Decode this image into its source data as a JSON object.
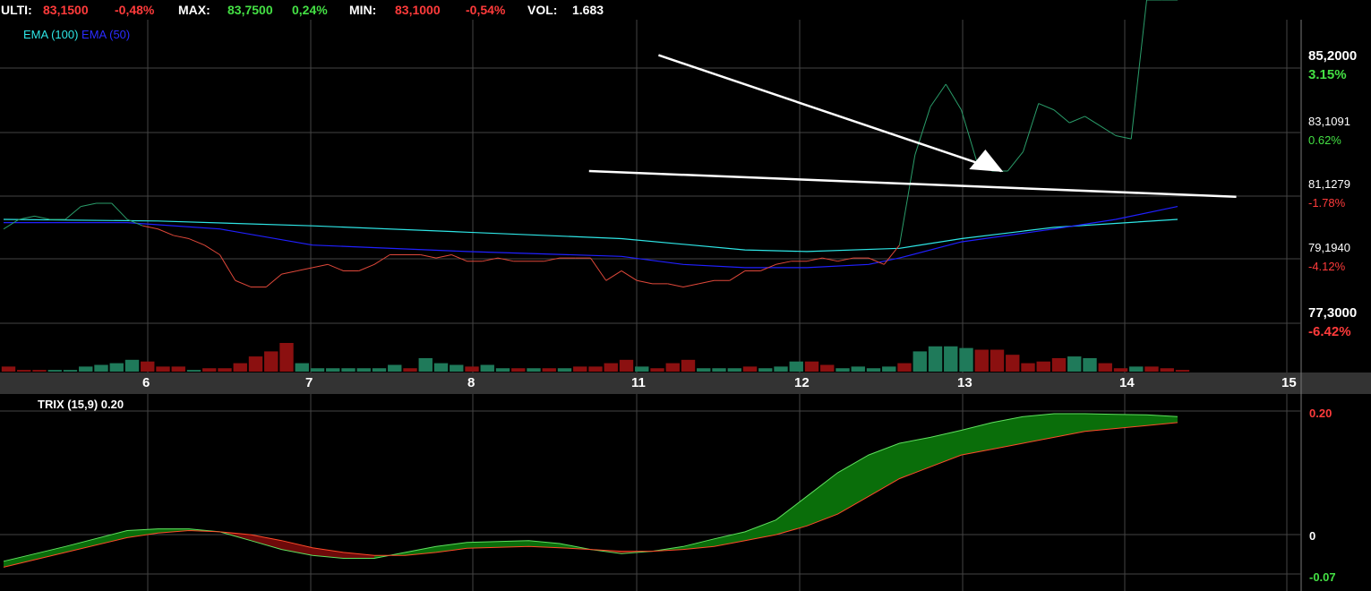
{
  "header": {
    "last_label": "ULTI:",
    "last_value": "83,1500",
    "last_change": "-0,48%",
    "max_label": "MAX:",
    "max_value": "83,7500",
    "max_change": "0,24%",
    "min_label": "MIN:",
    "min_value": "83,1000",
    "min_change": "-0,54%",
    "vol_label": "VOL:",
    "vol_value": "1.683"
  },
  "legend": {
    "ema100": "EMA (100)",
    "ema50": "EMA (50)"
  },
  "trix_title": "TRIX (15,9) 0.20",
  "colors": {
    "ema100": "#2ee6e6",
    "ema50": "#2020ff",
    "price_up": "#2a9d6a",
    "price_down": "#e0483a",
    "vol_up": "#1f7a5a",
    "vol_down": "#8b1010",
    "trix_up": "#0a6e0a",
    "trix_down": "#6e0a0a",
    "pos": "#44e044",
    "neg": "#ff3b3b"
  },
  "chart_data": [
    {
      "type": "line",
      "title": "",
      "x_ticks": [
        "6",
        "7",
        "8",
        "11",
        "12",
        "13",
        "14",
        "15"
      ],
      "y_labels": [
        {
          "value": "85,2000",
          "pct": "3.15%",
          "sign": "pos",
          "big": true
        },
        {
          "value": "83,1091",
          "pct": "0.62%",
          "sign": "pos",
          "big": false
        },
        {
          "value": "81,1279",
          "pct": "-1.78%",
          "sign": "neg",
          "big": false
        },
        {
          "value": "79,1940",
          "pct": "-4.12%",
          "sign": "neg",
          "big": false
        },
        {
          "value": "77,3000",
          "pct": "-6.42%",
          "sign": "neg",
          "big": true
        }
      ],
      "ylim": [
        77.3,
        85.2
      ],
      "xlim": [
        0,
        84
      ],
      "price": {
        "x": [
          0,
          1,
          2,
          3,
          4,
          5,
          6,
          7,
          8,
          9,
          10,
          11,
          12,
          13,
          14,
          15,
          16,
          17,
          18,
          19,
          20,
          21,
          22,
          23,
          24,
          25,
          26,
          27,
          28,
          29,
          30,
          31,
          32,
          33,
          34,
          35,
          36,
          37,
          38,
          39,
          40,
          41,
          42,
          43,
          44,
          45,
          46,
          47,
          48,
          49,
          50,
          51,
          52,
          53,
          54,
          55,
          56,
          57,
          58,
          59,
          60,
          61,
          62,
          63,
          64,
          65,
          66,
          67,
          68,
          69,
          70,
          71,
          72,
          73,
          74,
          75,
          76
        ],
        "y": [
          80.2,
          80.5,
          80.6,
          80.5,
          80.5,
          80.9,
          81.0,
          81.0,
          80.5,
          80.3,
          80.2,
          80.0,
          79.9,
          79.7,
          79.4,
          78.6,
          78.4,
          78.4,
          78.8,
          78.9,
          79.0,
          79.1,
          78.9,
          78.9,
          79.1,
          79.4,
          79.4,
          79.4,
          79.3,
          79.4,
          79.2,
          79.2,
          79.3,
          79.2,
          79.2,
          79.2,
          79.3,
          79.3,
          79.3,
          78.6,
          78.9,
          78.6,
          78.5,
          78.5,
          78.4,
          78.5,
          78.6,
          78.6,
          78.9,
          78.9,
          79.1,
          79.2,
          79.2,
          79.3,
          79.2,
          79.3,
          79.3,
          79.1,
          79.7,
          82.5,
          84.0,
          84.7,
          83.9,
          82.3,
          82.0,
          82.0,
          82.6,
          84.1,
          83.9,
          83.5,
          83.7,
          83.4,
          83.1,
          83.0
        ],
        "up_from_index": 58
      },
      "ema100": {
        "x": [
          0,
          10,
          20,
          30,
          40,
          48,
          52,
          58,
          62,
          68,
          76
        ],
        "y": [
          80.5,
          80.45,
          80.3,
          80.1,
          79.9,
          79.55,
          79.5,
          79.6,
          79.9,
          80.25,
          80.5
        ]
      },
      "ema50": {
        "x": [
          0,
          8,
          14,
          20,
          30,
          40,
          44,
          48,
          52,
          56,
          58,
          62,
          68,
          72,
          76
        ],
        "y": [
          80.4,
          80.4,
          80.2,
          79.7,
          79.5,
          79.35,
          79.1,
          79.0,
          79.0,
          79.1,
          79.3,
          79.8,
          80.2,
          80.5,
          80.9
        ]
      },
      "trendlines": [
        {
          "x": [
            42.4,
            64.6
          ],
          "y": [
            85.6,
            82.0
          ]
        },
        {
          "x": [
            37.9,
            79.8
          ],
          "y": [
            82.0,
            81.2
          ]
        }
      ],
      "volume": {
        "values": [
          3,
          1,
          1,
          1,
          1,
          3,
          4,
          5,
          7,
          6,
          3,
          3,
          1,
          2,
          2,
          5,
          9,
          12,
          17,
          5,
          2,
          2,
          2,
          2,
          2,
          4,
          2,
          8,
          5,
          4,
          3,
          4,
          2,
          2,
          2,
          2,
          2,
          3,
          3,
          5,
          7,
          3,
          2,
          5,
          7,
          2,
          2,
          2,
          3,
          2,
          3,
          6,
          6,
          4,
          2,
          3,
          2,
          3,
          5,
          12,
          15,
          15,
          14,
          13,
          13,
          10,
          5,
          6,
          8,
          9,
          8,
          5,
          2,
          3,
          3,
          2,
          1
        ],
        "up": [
          false,
          false,
          false,
          true,
          true,
          true,
          true,
          true,
          true,
          false,
          false,
          false,
          true,
          false,
          false,
          false,
          false,
          false,
          false,
          true,
          true,
          true,
          true,
          true,
          true,
          true,
          false,
          true,
          true,
          true,
          false,
          true,
          true,
          false,
          true,
          false,
          true,
          false,
          false,
          false,
          false,
          true,
          false,
          false,
          false,
          true,
          true,
          true,
          false,
          true,
          true,
          true,
          false,
          false,
          true,
          true,
          true,
          true,
          false,
          true,
          true,
          true,
          true,
          false,
          false,
          false,
          false,
          false,
          false,
          true,
          true,
          false,
          false,
          true,
          false,
          false,
          false
        ],
        "max": 17
      }
    },
    {
      "type": "area",
      "title": "TRIX (15,9) 0.20",
      "y_labels": [
        {
          "value": "0.20",
          "color": "neg"
        },
        {
          "value": "0",
          "color": "white"
        },
        {
          "value": "-0.07",
          "color": "pos"
        }
      ],
      "ylim": [
        -0.07,
        0.2
      ],
      "trix": {
        "x": [
          0,
          4,
          8,
          10,
          12,
          14,
          16,
          18,
          20,
          22,
          24,
          26,
          28,
          30,
          34,
          36,
          38,
          40,
          42,
          44,
          46,
          48,
          50,
          52,
          54,
          56,
          58,
          60,
          62,
          64,
          66,
          68,
          70,
          72,
          74,
          76
        ],
        "y": [
          -0.05,
          -0.025,
          0.002,
          0.005,
          0.005,
          0.0,
          -0.015,
          -0.03,
          -0.04,
          -0.045,
          -0.045,
          -0.035,
          -0.025,
          -0.018,
          -0.015,
          -0.02,
          -0.03,
          -0.037,
          -0.033,
          -0.025,
          -0.012,
          0.0,
          0.02,
          0.06,
          0.1,
          0.13,
          0.15,
          0.16,
          0.172,
          0.185,
          0.195,
          0.2,
          0.2,
          0.199,
          0.198,
          0.195
        ]
      },
      "signal": {
        "x": [
          0,
          4,
          8,
          10,
          12,
          14,
          16,
          18,
          20,
          22,
          24,
          26,
          28,
          30,
          34,
          36,
          38,
          40,
          42,
          44,
          46,
          48,
          50,
          52,
          54,
          56,
          58,
          60,
          62,
          64,
          66,
          68,
          70,
          72,
          74,
          76
        ],
        "y": [
          -0.06,
          -0.035,
          -0.01,
          -0.002,
          0.002,
          0.0,
          -0.005,
          -0.015,
          -0.027,
          -0.035,
          -0.04,
          -0.04,
          -0.035,
          -0.028,
          -0.025,
          -0.027,
          -0.03,
          -0.033,
          -0.033,
          -0.03,
          -0.025,
          -0.015,
          -0.005,
          0.01,
          0.03,
          0.06,
          0.09,
          0.11,
          0.13,
          0.14,
          0.15,
          0.16,
          0.17,
          0.175,
          0.18,
          0.185
        ]
      }
    }
  ]
}
